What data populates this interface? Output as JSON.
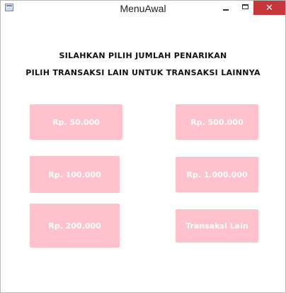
{
  "window": {
    "title": "MenuAwal",
    "close_symbol": "✕"
  },
  "header": {
    "line1": "SILAHKAN PILIH JUMLAH PENARIKAN",
    "line2": "PILIH TRANSAKSI LAIN UNTUK TRANSAKSI LAINNYA"
  },
  "buttons": {
    "amount_50000": "Rp. 50.000",
    "amount_100000": "Rp. 100.000",
    "amount_200000": "Rp. 200.000",
    "amount_500000": "Rp. 500.000",
    "amount_1000000": "Rp. 1.000.000",
    "other_transaction": "Transaksi Lain"
  },
  "colors": {
    "button_bg": "#ffc2cc",
    "button_text": "#ffffff",
    "close_bg": "#c7373a"
  }
}
